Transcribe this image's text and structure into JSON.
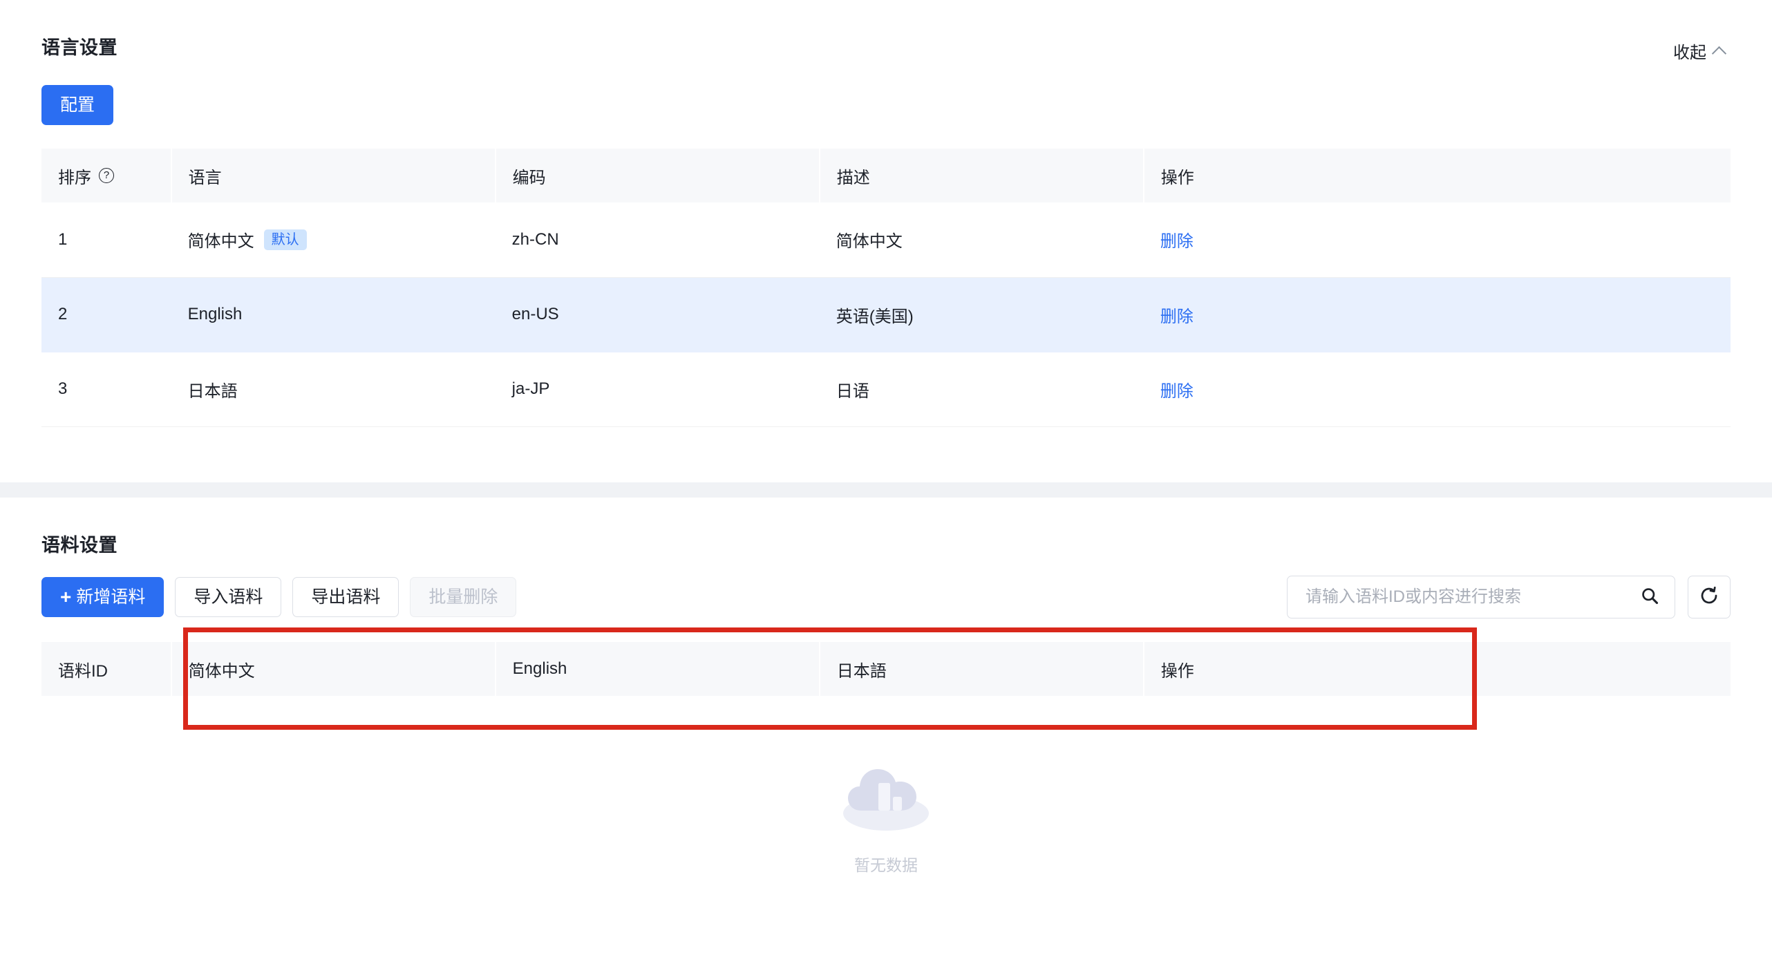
{
  "language_section": {
    "title": "语言设置",
    "collapse_label": "收起",
    "collapse_icon": "chevron-up-icon",
    "config_button": "配置",
    "columns": [
      "排序",
      "语言",
      "编码",
      "描述",
      "操作"
    ],
    "sort_help_icon": "question-circle-icon",
    "rows": [
      {
        "order": "1",
        "language": "简体中文",
        "badge": "默认",
        "code": "zh-CN",
        "description": "简体中文",
        "action": "删除",
        "highlighted": false
      },
      {
        "order": "2",
        "language": "English",
        "badge": "",
        "code": "en-US",
        "description": "英语(美国)",
        "action": "删除",
        "highlighted": true
      },
      {
        "order": "3",
        "language": "日本語",
        "badge": "",
        "code": "ja-JP",
        "description": "日语",
        "action": "删除",
        "highlighted": false
      }
    ]
  },
  "corpus_section": {
    "title": "语料设置",
    "toolbar": {
      "add_label": "新增语料",
      "add_icon": "plus-icon",
      "import_label": "导入语料",
      "export_label": "导出语料",
      "batch_delete_label": "批量删除",
      "batch_delete_disabled": true,
      "search_placeholder": "请输入语料ID或内容进行搜索",
      "search_value": "",
      "search_icon": "search-icon",
      "refresh_icon": "refresh-icon"
    },
    "columns": [
      "语料ID",
      "简体中文",
      "English",
      "日本語",
      "操作"
    ],
    "rows": [],
    "empty": {
      "text": "暂无数据",
      "icon": "empty-cloud-icon"
    }
  },
  "annotation": {
    "type": "highlight-rectangle",
    "color": "#d9281b"
  },
  "colors": {
    "primary": "#2b6ef2",
    "link": "#2b6ef2",
    "badge_bg": "#cfe4fd",
    "row_highlight": "#e8f0fe",
    "table_header_bg": "#f7f8fa",
    "page_bg": "#f0f2f5",
    "annotation": "#d9281b"
  }
}
